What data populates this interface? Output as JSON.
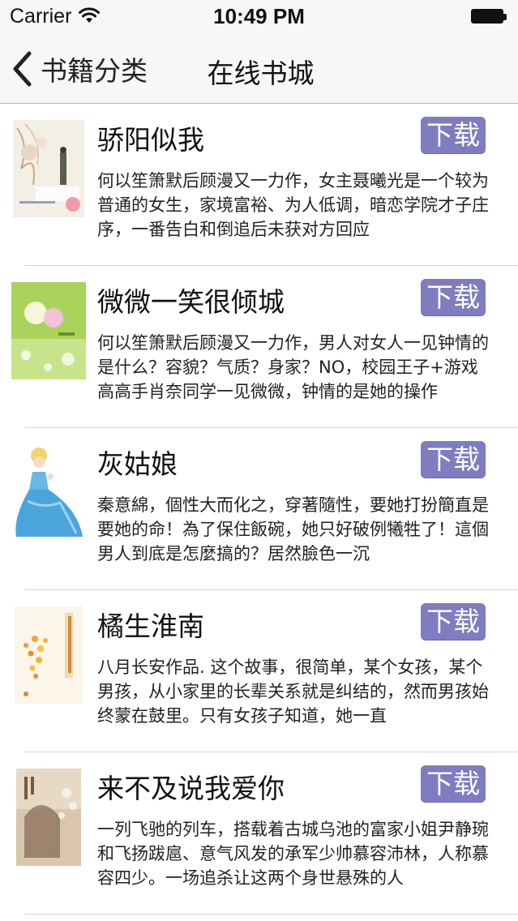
{
  "status_bar": {
    "carrier": "Carrier",
    "time": "10:49 PM",
    "wifi_icon": "wifi-icon",
    "battery_icon": "battery-icon"
  },
  "nav": {
    "back_label": "书籍分类",
    "title": "在线书城",
    "back_icon": "chevron-left-icon"
  },
  "colors": {
    "accent": "#7f7cbf",
    "navbar_bg": "#f7f7f7",
    "divider": "#d6d6d6"
  },
  "books": [
    {
      "title": "骄阳似我",
      "download_label": "下载",
      "description": "何以笙箫默后顾漫又一力作，女主聂曦光是一个较为普通的女生，家境富裕、为人低调，暗恋学院才子庄序，一番告白和倒追后未获对方回应"
    },
    {
      "title": "微微一笑很倾城",
      "download_label": "下载",
      "description": "何以笙箫默后顾漫又一力作，男人对女人一见钟情的是什么？容貌？气质？身家？NO，校园王子+游戏高高手肖奈同学一见微微，钟情的是她的操作"
    },
    {
      "title": "灰姑娘",
      "download_label": "下载",
      "description": "秦意綿，個性大而化之，穿著隨性，要她打扮簡直是要她的命！為了保住飯碗，她只好破例犧牲了！這個男人到底是怎麼搞的？居然臉色一沉"
    },
    {
      "title": "橘生淮南",
      "download_label": "下载",
      "description": "八月长安作品. 这个故事，很简单，某个女孩，某个男孩，从小家里的长辈关系就是纠结的，然而男孩始终蒙在鼓里。只有女孩子知道，她一直"
    },
    {
      "title": "来不及说我爱你",
      "download_label": "下载",
      "description": "一列飞驰的列车，搭载着古城乌池的富家小姐尹静琬和飞扬跋扈、意气风发的承军少帅慕容沛林，人称慕容四少。一场追杀让这两个身世悬殊的人"
    }
  ]
}
